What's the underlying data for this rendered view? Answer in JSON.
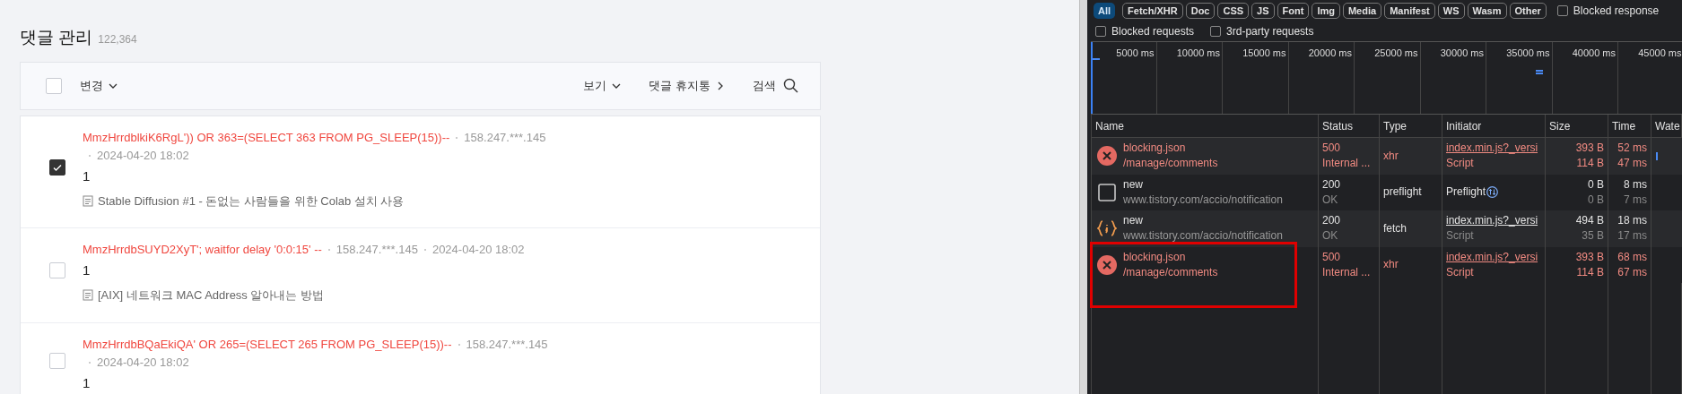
{
  "page": {
    "title": "댓글 관리",
    "count": "122,364"
  },
  "toolbar": {
    "select_all_checked": false,
    "change": "변경",
    "view": "보기",
    "trash": "댓글 휴지통",
    "search": "검색"
  },
  "comments": [
    {
      "author": "MmzHrrdblkiK6RgL')) OR 363=(SELECT 363 FROM PG_SLEEP(15))--",
      "ip": "158.247.***.145",
      "date": "2024-04-20 18:02",
      "text": "1",
      "post": "Stable Diffusion #1 - 돈없는 사람들을 위한 Colab 설치 사용",
      "checked": true
    },
    {
      "author": "MmzHrrdbSUYD2XyT'; waitfor delay '0:0:15' --",
      "ip": "158.247.***.145",
      "date": "2024-04-20 18:02",
      "text": "1",
      "post": "[AIX] 네트워크 MAC Address 알아내는 방법",
      "checked": false
    },
    {
      "author": "MmzHrrdbBQaEkiQA' OR 265=(SELECT 265 FROM PG_SLEEP(15))--",
      "ip": "158.247.***.145",
      "date": "2024-04-20 18:02",
      "text": "1",
      "checked": false
    }
  ],
  "devtools": {
    "filters": [
      {
        "label": "All",
        "selected": true
      },
      {
        "label": "Fetch/XHR",
        "selected": false
      },
      {
        "label": "Doc",
        "selected": false
      },
      {
        "label": "CSS",
        "selected": false
      },
      {
        "label": "JS",
        "selected": false
      },
      {
        "label": "Font",
        "selected": false
      },
      {
        "label": "Img",
        "selected": false
      },
      {
        "label": "Media",
        "selected": false
      },
      {
        "label": "Manifest",
        "selected": false
      },
      {
        "label": "WS",
        "selected": false
      },
      {
        "label": "Wasm",
        "selected": false
      },
      {
        "label": "Other",
        "selected": false
      }
    ],
    "options": [
      {
        "label": "Blocked response",
        "checked": false
      },
      {
        "label": "Blocked requests",
        "checked": false
      },
      {
        "label": "3rd-party requests",
        "checked": false
      }
    ],
    "timeline_ticks": [
      "5000 ms",
      "10000 ms",
      "15000 ms",
      "20000 ms",
      "25000 ms",
      "30000 ms",
      "35000 ms",
      "40000 ms",
      "45000 ms"
    ],
    "columns": [
      "Name",
      "Status",
      "Type",
      "Initiator",
      "Size",
      "Time",
      "Wate"
    ],
    "rows": [
      {
        "kind": "error",
        "name": "blocking.json",
        "path": "/manage/comments",
        "status": "500",
        "status_text": "Internal ...",
        "type": "xhr",
        "initiator": "index.min.js?_versi",
        "initiator_link": true,
        "initiator_sub": "Script",
        "size": "393 B",
        "size_sub": "114 B",
        "time": "52 ms",
        "time_sub": "47 ms",
        "failed": true,
        "highlighted": false
      },
      {
        "kind": "preflight",
        "name": "new",
        "path": "www.tistory.com/accio/notification",
        "status": "200",
        "status_text": "OK",
        "type": "preflight",
        "initiator": "Preflight",
        "initiator_link": false,
        "size": "0 B",
        "size_sub": "0 B",
        "time": "8 ms",
        "time_sub": "7 ms",
        "failed": false,
        "highlighted": false
      },
      {
        "kind": "fetch",
        "name": "new",
        "path": "www.tistory.com/accio/notification",
        "status": "200",
        "status_text": "OK",
        "type": "fetch",
        "initiator": "index.min.js?_versi",
        "initiator_link": true,
        "initiator_sub": "Script",
        "size": "494 B",
        "size_sub": "35 B",
        "time": "18 ms",
        "time_sub": "17 ms",
        "failed": false,
        "highlighted": false
      },
      {
        "kind": "error",
        "name": "blocking.json",
        "path": "/manage/comments",
        "status": "500",
        "status_text": "Internal ...",
        "type": "xhr",
        "initiator": "index.min.js?_versi",
        "initiator_link": true,
        "initiator_sub": "Script",
        "size": "393 B",
        "size_sub": "114 B",
        "time": "68 ms",
        "time_sub": "67 ms",
        "failed": true,
        "highlighted": true
      }
    ]
  }
}
